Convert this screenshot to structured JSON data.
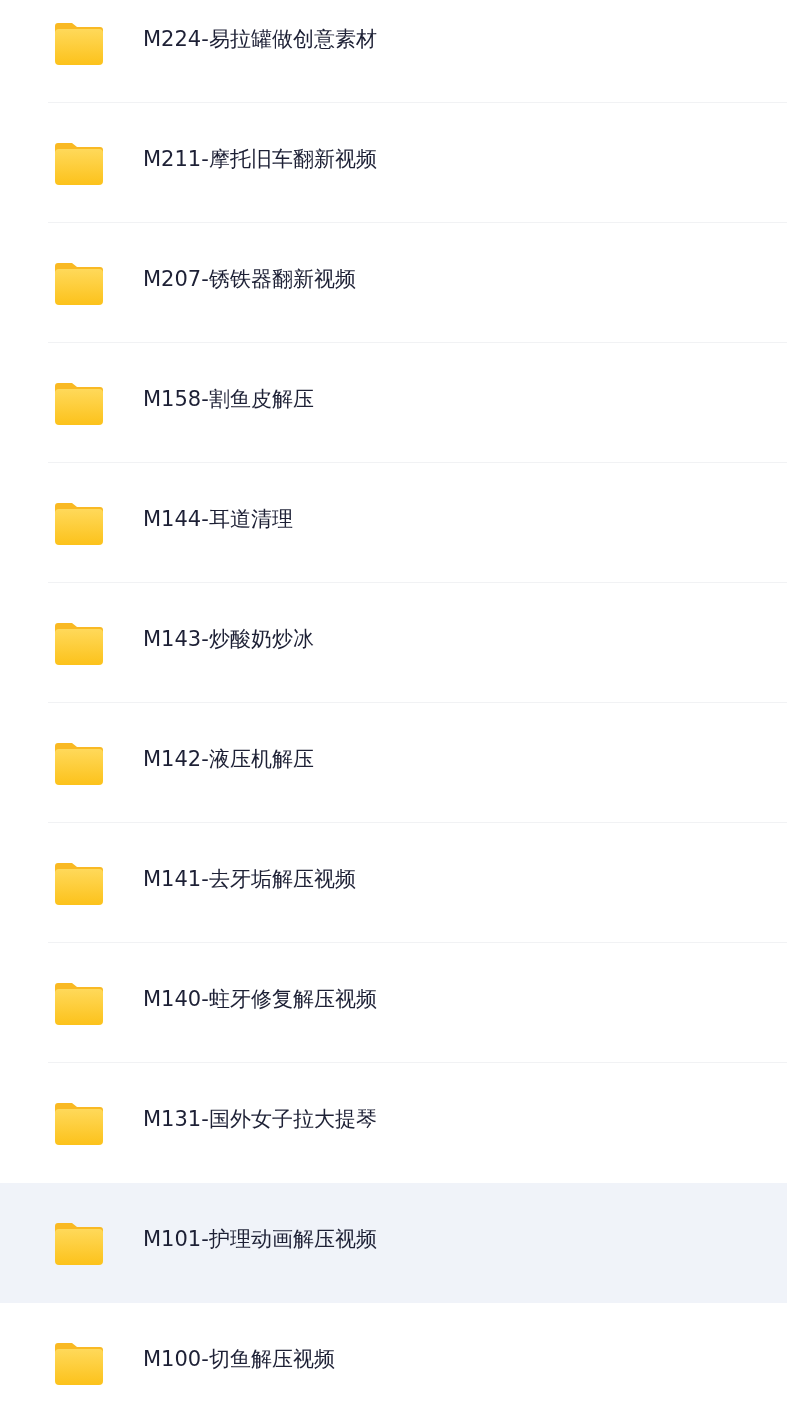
{
  "folders": [
    {
      "name": "M224-易拉罐做创意素材",
      "selected": false
    },
    {
      "name": "M211-摩托旧车翻新视频",
      "selected": false
    },
    {
      "name": "M207-锈铁器翻新视频",
      "selected": false
    },
    {
      "name": "M158-割鱼皮解压",
      "selected": false
    },
    {
      "name": "M144-耳道清理",
      "selected": false
    },
    {
      "name": "M143-炒酸奶炒冰",
      "selected": false
    },
    {
      "name": "M142-液压机解压",
      "selected": false
    },
    {
      "name": "M141-去牙垢解压视频",
      "selected": false
    },
    {
      "name": "M140-蛀牙修复解压视频",
      "selected": false
    },
    {
      "name": "M131-国外女子拉大提琴",
      "selected": false
    },
    {
      "name": "M101-护理动画解压视频",
      "selected": true
    },
    {
      "name": "M100-切鱼解压视频",
      "selected": false
    }
  ]
}
